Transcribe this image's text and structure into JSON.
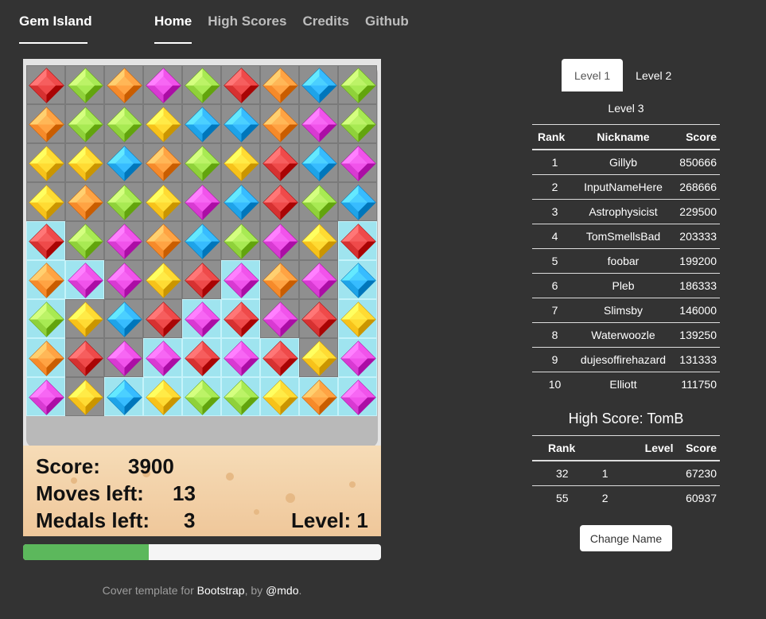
{
  "nav": {
    "brand": "Gem Island",
    "links": [
      "Home",
      "High Scores",
      "Credits",
      "Github"
    ]
  },
  "game": {
    "grid": [
      [
        "red",
        "green",
        "orange",
        "magenta",
        "green",
        "red",
        "orange",
        "blue",
        "green"
      ],
      [
        "orange",
        "green",
        "green",
        "yellow",
        "blue",
        "blue",
        "orange",
        "magenta",
        "green"
      ],
      [
        "yellow",
        "yellow",
        "blue",
        "orange",
        "green",
        "yellow",
        "red",
        "blue",
        "magenta"
      ],
      [
        "yellow",
        "orange",
        "green",
        "yellow",
        "magenta",
        "blue",
        "red",
        "green",
        "blue"
      ],
      [
        "red",
        "green",
        "magenta",
        "orange",
        "blue",
        "green",
        "magenta",
        "yellow",
        "red"
      ],
      [
        "orange",
        "magenta",
        "magenta",
        "yellow",
        "red",
        "magenta",
        "orange",
        "magenta",
        "blue"
      ],
      [
        "green",
        "yellow",
        "blue",
        "red",
        "magenta",
        "red",
        "magenta",
        "red",
        "yellow"
      ],
      [
        "orange",
        "red",
        "magenta",
        "magenta",
        "red",
        "magenta",
        "red",
        "yellow",
        "magenta"
      ],
      [
        "magenta",
        "yellow",
        "blue",
        "yellow",
        "green",
        "green",
        "yellow",
        "orange",
        "magenta"
      ]
    ],
    "ice": [
      [
        0,
        0,
        0,
        0,
        0,
        0,
        0,
        0,
        0
      ],
      [
        0,
        0,
        0,
        0,
        0,
        0,
        0,
        0,
        0
      ],
      [
        0,
        0,
        0,
        0,
        0,
        0,
        0,
        0,
        0
      ],
      [
        0,
        0,
        0,
        0,
        0,
        0,
        0,
        0,
        0
      ],
      [
        1,
        0,
        0,
        0,
        0,
        0,
        0,
        0,
        1
      ],
      [
        1,
        1,
        0,
        0,
        0,
        1,
        0,
        0,
        1
      ],
      [
        1,
        0,
        0,
        0,
        1,
        1,
        0,
        0,
        1
      ],
      [
        1,
        0,
        0,
        1,
        1,
        1,
        1,
        0,
        1
      ],
      [
        1,
        0,
        1,
        1,
        1,
        1,
        1,
        1,
        1
      ]
    ],
    "gem_colors": {
      "red": "#d63131",
      "green": "#8fd13a",
      "orange": "#f68a2a",
      "magenta": "#d83ad2",
      "yellow": "#f7c21a",
      "blue": "#1ea3e8"
    },
    "score_label": "Score:",
    "score": "3900",
    "moves_label": "Moves left:",
    "moves": "13",
    "medals_label": "Medals left:",
    "medals": "3",
    "level_text": "Level: 1",
    "progress": 0.35
  },
  "footer": {
    "prefix": "Cover template for ",
    "bootstrap": "Bootstrap",
    "middle": ", by ",
    "author": "@mdo",
    "suffix": "."
  },
  "leaderboard": {
    "tabs": [
      "Level 1",
      "Level 2"
    ],
    "tab3": "Level 3",
    "headers": [
      "Rank",
      "Nickname",
      "Score"
    ],
    "rows": [
      [
        "1",
        "Gillyb",
        "850666"
      ],
      [
        "2",
        "InputNameHere",
        "268666"
      ],
      [
        "3",
        "Astrophysicist",
        "229500"
      ],
      [
        "4",
        "TomSmellsBad",
        "203333"
      ],
      [
        "5",
        "foobar",
        "199200"
      ],
      [
        "6",
        "Pleb",
        "186333"
      ],
      [
        "7",
        "Slimsby",
        "146000"
      ],
      [
        "8",
        "Waterwoozle",
        "139250"
      ],
      [
        "9",
        "dujesoffirehazard",
        "131333"
      ],
      [
        "10",
        "Elliott",
        "111750"
      ]
    ]
  },
  "user_scores": {
    "title": "High Score: TomB",
    "headers": [
      "Rank",
      "Level",
      "Score"
    ],
    "rows": [
      [
        "32",
        "1",
        "67230"
      ],
      [
        "55",
        "2",
        "60937"
      ]
    ]
  },
  "change_name_label": "Change Name"
}
